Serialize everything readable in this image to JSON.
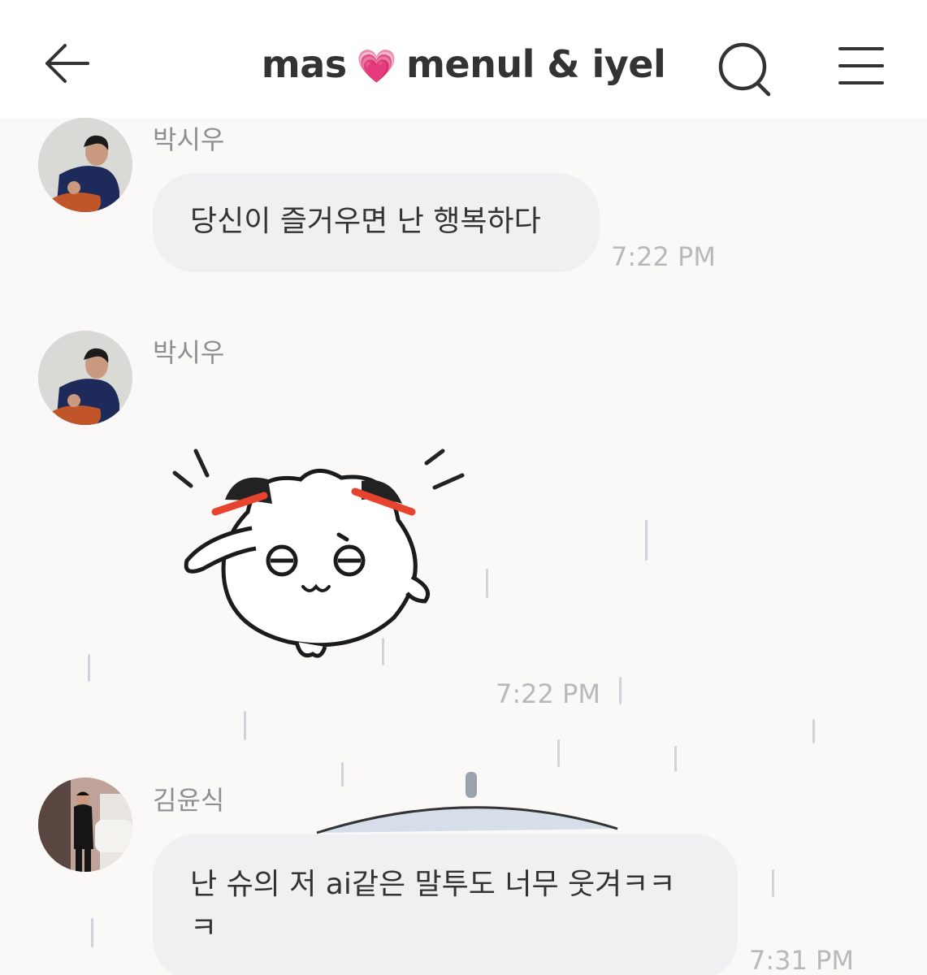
{
  "header": {
    "title_left": "mas",
    "title_heart": "💗",
    "title_right": "menul & iyel",
    "back_icon": "arrow-left-icon",
    "search_icon": "search-icon",
    "menu_icon": "hamburger-menu-icon"
  },
  "messages": [
    {
      "sender": "박시우",
      "text": "당신이 즐거우면 난 행복하다",
      "time": "7:22 PM"
    },
    {
      "sender": "박시우",
      "sticker": "saluting-dumpling-sticker",
      "time": "7:22 PM"
    },
    {
      "sender": "김윤식",
      "text_line1": "난 슈의 저 ai같은 말투도 너무 웃겨ㅋㅋ",
      "text_line2": "ㅋ",
      "time": "7:31 PM"
    }
  ],
  "colors": {
    "background": "#fbf8f8",
    "bubble": "#f0f0f3",
    "heart": "#e64a9e",
    "sticker_accent": "#e8432e"
  }
}
